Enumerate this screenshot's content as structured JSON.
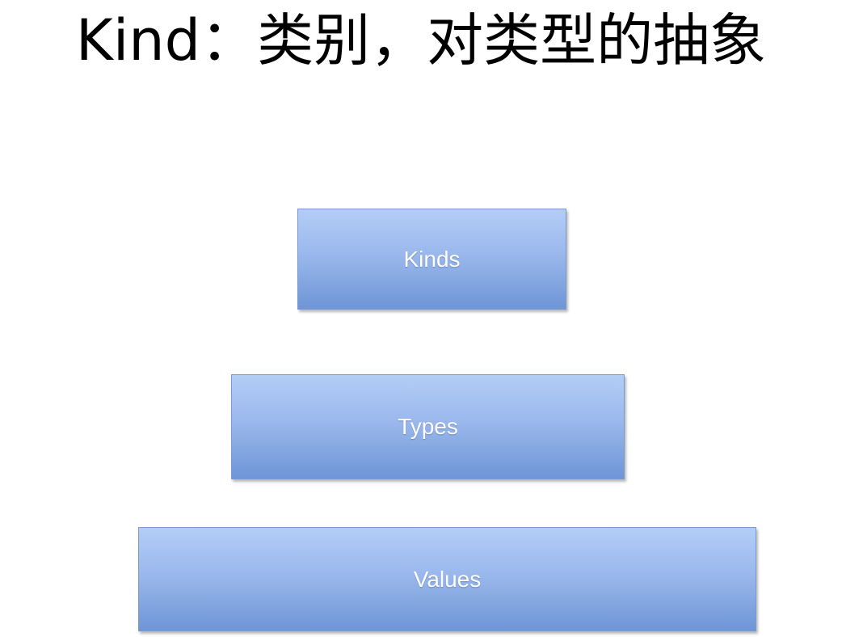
{
  "title": "Kind：类别，对类型的抽象",
  "layers": [
    {
      "label": "Kinds"
    },
    {
      "label": "Types"
    },
    {
      "label": "Values"
    }
  ],
  "colors": {
    "box_top": "#b3cdf7",
    "box_bottom": "#6f95d6",
    "box_border": "#7a9bd0",
    "label_text": "#ffffff",
    "title_text": "#000000"
  }
}
